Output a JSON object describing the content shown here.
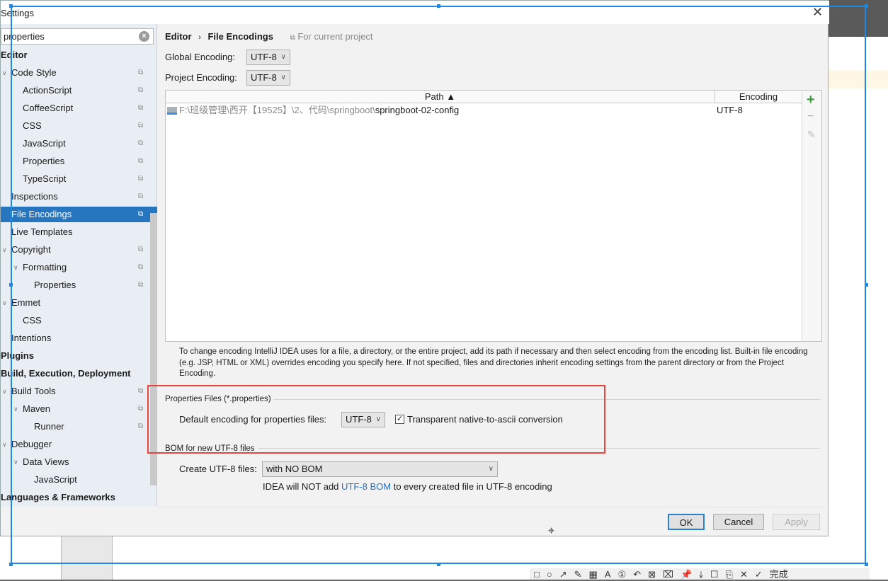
{
  "window": {
    "title": "Settings",
    "close_icon": "close-icon"
  },
  "search": {
    "value": "properties",
    "clear_icon": "clear-circle-icon"
  },
  "sidebar": {
    "items": [
      {
        "label": "Editor",
        "level": 0,
        "bold": true
      },
      {
        "label": "Code Style",
        "level": 1,
        "arrow": true,
        "copy": true
      },
      {
        "label": "ActionScript",
        "level": 2,
        "copy": true
      },
      {
        "label": "CoffeeScript",
        "level": 2,
        "copy": true
      },
      {
        "label": "CSS",
        "level": 2,
        "copy": true
      },
      {
        "label": "JavaScript",
        "level": 2,
        "copy": true
      },
      {
        "label": "Properties",
        "level": 2,
        "copy": true
      },
      {
        "label": "TypeScript",
        "level": 2,
        "copy": true
      },
      {
        "label": "Inspections",
        "level": 1,
        "copy": true
      },
      {
        "label": "File Encodings",
        "level": 1,
        "copy": true,
        "selected": true
      },
      {
        "label": "Live Templates",
        "level": 1
      },
      {
        "label": "Copyright",
        "level": 1,
        "arrow": true,
        "copy": true
      },
      {
        "label": "Formatting",
        "level": 2,
        "arrow": true,
        "copy": true
      },
      {
        "label": "Properties",
        "level": 3,
        "copy": true
      },
      {
        "label": "Emmet",
        "level": 1,
        "arrow": true
      },
      {
        "label": "CSS",
        "level": 2
      },
      {
        "label": "Intentions",
        "level": 1
      },
      {
        "label": "Plugins",
        "level": 0,
        "bold": true
      },
      {
        "label": "Build, Execution, Deployment",
        "level": 0,
        "bold": true
      },
      {
        "label": "Build Tools",
        "level": 1,
        "arrow": true,
        "copy": true
      },
      {
        "label": "Maven",
        "level": 2,
        "arrow": true,
        "copy": true
      },
      {
        "label": "Runner",
        "level": 3,
        "copy": true
      },
      {
        "label": "Debugger",
        "level": 1,
        "arrow": true
      },
      {
        "label": "Data Views",
        "level": 2,
        "arrow": true
      },
      {
        "label": "JavaScript",
        "level": 3
      },
      {
        "label": "Languages & Frameworks",
        "level": 0,
        "bold": true
      }
    ]
  },
  "breadcrumb": {
    "parent": "Editor",
    "separator": "›",
    "current": "File Encodings",
    "scope": "For current project"
  },
  "global_encoding": {
    "label": "Global Encoding:",
    "value": "UTF-8"
  },
  "project_encoding": {
    "label": "Project Encoding:",
    "value": "UTF-8"
  },
  "table": {
    "columns": [
      "Path ▲",
      "Encoding"
    ],
    "rows": [
      {
        "path_prefix": "F:\\班级管理\\西开【19525】\\2、代码\\springboot\\",
        "path_name": "springboot-02-config",
        "encoding": "UTF-8"
      }
    ],
    "actions": {
      "add": "+",
      "remove": "−",
      "edit": "✎"
    }
  },
  "hint": "To change encoding IntelliJ IDEA uses for a file, a directory, or the entire project, add its path if necessary and then select encoding from the encoding list. Built-in file encoding (e.g. JSP, HTML or XML) overrides encoding you specify here. If not specified, files and directories inherit encoding settings from the parent directory or from the Project Encoding.",
  "properties_files": {
    "title": "Properties Files (*.properties)",
    "label": "Default encoding for properties files:",
    "value": "UTF-8",
    "checkbox_label": "Transparent native-to-ascii conversion",
    "checked": true
  },
  "bom": {
    "title": "BOM for new UTF-8 files",
    "label": "Create UTF-8 files:",
    "value": "with NO BOM",
    "note_pre": "IDEA will NOT add ",
    "note_link": "UTF-8 BOM",
    "note_post": " to every created file in UTF-8 encoding"
  },
  "buttons": {
    "ok": "OK",
    "cancel": "Cancel",
    "apply": "Apply"
  },
  "toolbar": {
    "icons": [
      "rectangle-icon",
      "ellipse-icon",
      "arrow-icon",
      "pen-icon",
      "mosaic-icon",
      "text-icon",
      "number-icon",
      "undo-icon",
      "delete-icon",
      "clear-icon",
      "pin-icon",
      "download-icon",
      "save-icon",
      "copy-icon",
      "cancel-icon",
      "done-icon"
    ],
    "glyphs": [
      "□",
      "○",
      "↗",
      "✎",
      "▦",
      "A",
      "①",
      "↶",
      "⊠",
      "⌧",
      "📌",
      "⤓",
      "☐",
      "⎘",
      "✕",
      "✓"
    ],
    "done_label": "完成"
  },
  "colors": {
    "selection": "#2675bf",
    "highlight_box": "#e8453c",
    "link": "#2470c2"
  }
}
